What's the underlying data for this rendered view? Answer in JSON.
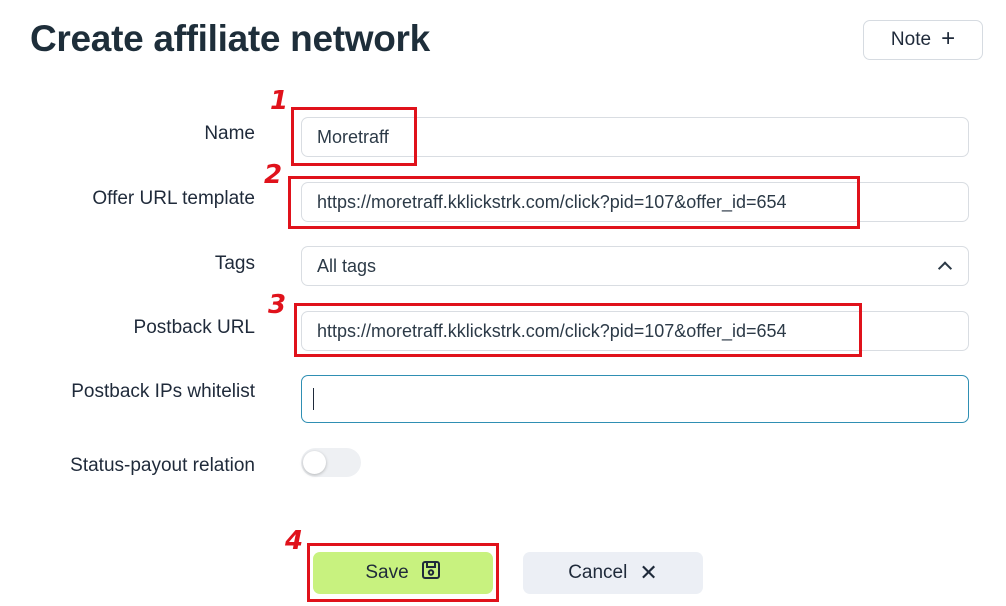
{
  "page": {
    "title": "Create affiliate network",
    "note_label": "Note"
  },
  "form": {
    "name": {
      "label": "Name",
      "value": "Moretraff"
    },
    "offer_url": {
      "label": "Offer URL template",
      "value": "https://moretraff.kklickstrk.com/click?pid=107&offer_id=654"
    },
    "tags": {
      "label": "Tags",
      "value": "All tags"
    },
    "postback_url": {
      "label": "Postback URL",
      "value": "https://moretraff.kklickstrk.com/click?pid=107&offer_id=654"
    },
    "postback_ips": {
      "label": "Postback IPs whitelist",
      "value": ""
    },
    "status_payout": {
      "label": "Status-payout relation",
      "enabled": false
    }
  },
  "actions": {
    "save_label": "Save",
    "cancel_label": "Cancel"
  },
  "annotations": {
    "marker_1": "1",
    "marker_2": "2",
    "marker_3": "3",
    "marker_4": "4",
    "color": "#e0121b"
  },
  "colors": {
    "save_bg": "#c8f27f",
    "cancel_bg": "#eceff5",
    "focus_border": "#2f8fb3"
  }
}
